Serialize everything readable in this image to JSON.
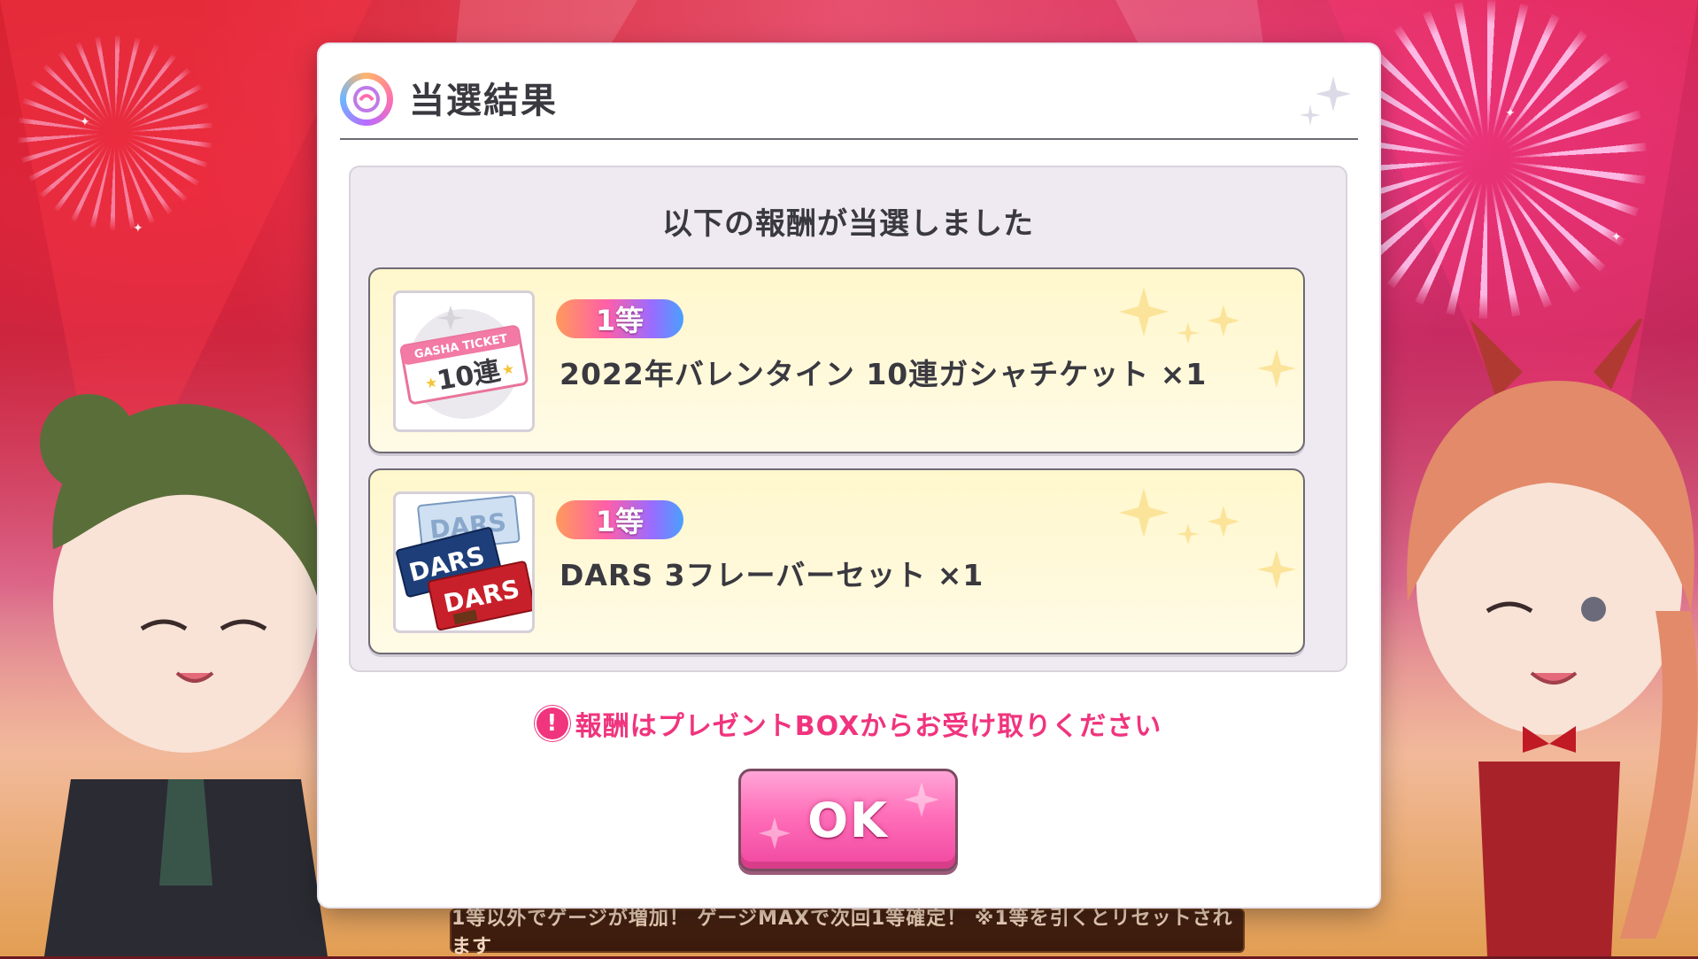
{
  "modal": {
    "title": "当選結果",
    "heading": "以下の報酬が当選しました",
    "rewards": [
      {
        "rank": "1等",
        "name": "2022年バレンタイン 10連ガシャチケット ×1",
        "icon": "gasha-ticket-icon",
        "ticket_top": "GASHA TICKET",
        "ticket_main": "10連"
      },
      {
        "rank": "1等",
        "name": "DARS 3フレーバーセット ×1",
        "icon": "chocolate-box-icon",
        "box_label": "DARS"
      }
    ],
    "notice": "報酬はプレゼントBOXからお受け取りください",
    "notice_icon": "!",
    "ok_label": "OK"
  },
  "gauge_banner": "1等以外でゲージが増加！ ゲージMAXで次回1等確定！ ※1等を引くとリセットされます",
  "colors": {
    "accent_pink": "#f0347e",
    "reward_bg": "#fff7cc",
    "panel_bg": "#efeaf2",
    "text": "#3a3940"
  }
}
